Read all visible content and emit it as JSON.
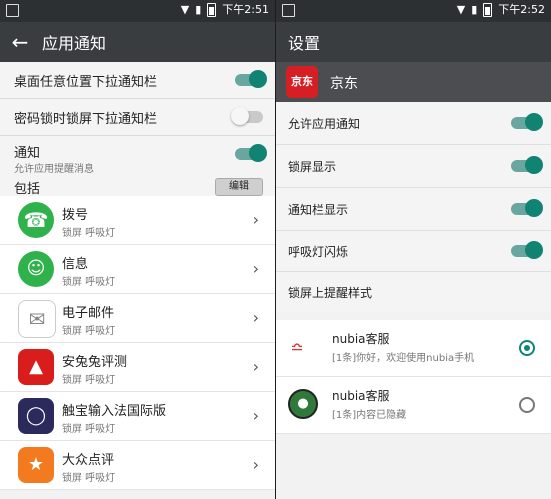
{
  "left": {
    "status": {
      "time": "下午2:51"
    },
    "appbar": {
      "back_icon": "arrow-left-icon",
      "title": "应用通知"
    },
    "settings": [
      {
        "label": "桌面任意位置下拉通知栏",
        "toggle": "on"
      },
      {
        "label": "密码锁时锁屏下拉通知栏",
        "toggle": "off"
      },
      {
        "label": "通知",
        "sub": "允许应用提醒消息",
        "toggle": "on"
      }
    ],
    "section": {
      "label": "包括",
      "edit_label": "编辑"
    },
    "apps": [
      {
        "name": "拨号",
        "sub": "锁屏    呼吸灯",
        "icon": "phone-icon",
        "color": "#2fb24b"
      },
      {
        "name": "信息",
        "sub": "锁屏    呼吸灯",
        "icon": "message-icon",
        "color": "#2fb24b"
      },
      {
        "name": "电子邮件",
        "sub": "锁屏    呼吸灯",
        "icon": "mail-icon",
        "color": "#ffffff"
      },
      {
        "name": "安兔兔评测",
        "sub": "锁屏    呼吸灯",
        "icon": "antutu-icon",
        "color": "#d91c1c"
      },
      {
        "name": "触宝输入法国际版",
        "sub": "锁屏    呼吸灯",
        "icon": "keyboard-icon",
        "color": "#2c2a5c"
      },
      {
        "name": "大众点评",
        "sub": "锁屏    呼吸灯",
        "icon": "dianping-icon",
        "color": "#f37a1f"
      }
    ]
  },
  "right": {
    "status": {
      "time": "下午2:52"
    },
    "appbar": {
      "title": "设置"
    },
    "brand": {
      "logo_text": "京东",
      "name": "京东"
    },
    "toggles": [
      {
        "label": "允许应用通知",
        "toggle": "on"
      },
      {
        "label": "锁屏显示",
        "toggle": "on"
      },
      {
        "label": "通知栏显示",
        "toggle": "on"
      },
      {
        "label": "呼吸灯闪烁",
        "toggle": "on"
      }
    ],
    "lock_style_label": "锁屏上提醒样式",
    "styles": [
      {
        "title": "nubia客服",
        "text": "[1条]你好，欢迎使用nubia手机",
        "selected": true,
        "icon": "wifi-signal-icon"
      },
      {
        "title": "nubia客服",
        "text": "[1条]内容已隐藏",
        "selected": false,
        "icon": "bubble-icon"
      }
    ]
  },
  "colors": {
    "accent": "#108373",
    "statusbar": "#2d3033",
    "appbar": "#3a3d40"
  }
}
